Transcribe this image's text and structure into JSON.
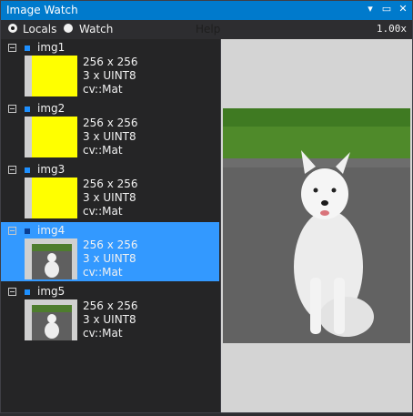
{
  "window": {
    "title": "Image Watch"
  },
  "toolbar": {
    "locals_label": "Locals",
    "watch_label": "Watch",
    "help_label": "Help",
    "zoom": "1.00x"
  },
  "items": [
    {
      "name": "img1",
      "size": "256 x 256",
      "type": "3 x UINT8",
      "class": "cv::Mat",
      "thumb": "yellow"
    },
    {
      "name": "img2",
      "size": "256 x 256",
      "type": "3 x UINT8",
      "class": "cv::Mat",
      "thumb": "yellow"
    },
    {
      "name": "img3",
      "size": "256 x 256",
      "type": "3 x UINT8",
      "class": "cv::Mat",
      "thumb": "yellow"
    },
    {
      "name": "img4",
      "size": "256 x 256",
      "type": "3 x UINT8",
      "class": "cv::Mat",
      "thumb": "dog",
      "selected": true
    },
    {
      "name": "img5",
      "size": "256 x 256",
      "type": "3 x UINT8",
      "class": "cv::Mat",
      "thumb": "dog"
    }
  ],
  "colors": {
    "accent": "#007acc",
    "selection": "#3399ff",
    "thumb_yellow": "#ffff00"
  }
}
